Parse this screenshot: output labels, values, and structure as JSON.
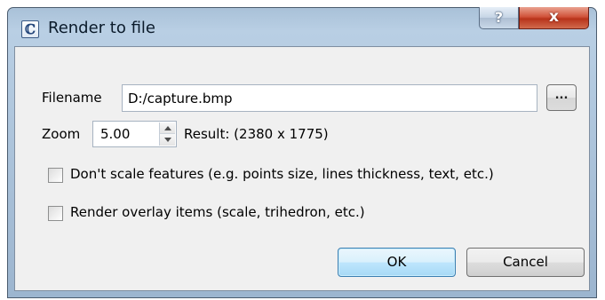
{
  "window": {
    "title": "Render to file",
    "app_icon": "ℂ",
    "help_label": "?",
    "close_label": "x"
  },
  "form": {
    "filename_label": "Filename",
    "filename_value": "D:/capture.bmp",
    "browse_label": "...",
    "zoom_label": "Zoom",
    "zoom_value": "5.00",
    "result_text": "Result:  (2380 x 1775)",
    "checkbox_scale_label": "Don't scale features (e.g. points size, lines thickness, text, etc.)",
    "checkbox_scale_checked": false,
    "checkbox_overlay_label": "Render overlay items (scale, trihedron, etc.)",
    "checkbox_overlay_checked": false
  },
  "buttons": {
    "ok": "OK",
    "cancel": "Cancel"
  },
  "colors": {
    "accent_ok_border": "#3c7fb1",
    "close_red": "#c9452c",
    "frame_blue": "#a9c1d8"
  }
}
